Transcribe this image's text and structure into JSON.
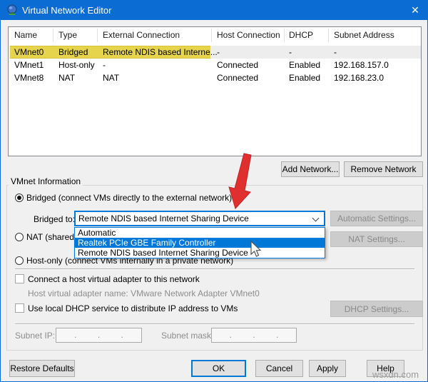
{
  "window": {
    "title": "Virtual Network Editor",
    "close_glyph": "✕"
  },
  "colors": {
    "accent": "#0078d7",
    "titlebar": "#0b6dd3",
    "row_highlight": "#e6d44c",
    "arrow_red": "#e02f2f"
  },
  "table": {
    "columns": [
      "Name",
      "Type",
      "External Connection",
      "Host Connection",
      "DHCP",
      "Subnet Address"
    ],
    "rows": [
      {
        "name": "VMnet0",
        "type": "Bridged",
        "external": "Remote NDIS based Interne...",
        "host": "-",
        "dhcp": "-",
        "subnet": "-"
      },
      {
        "name": "VMnet1",
        "type": "Host-only",
        "external": "-",
        "host": "Connected",
        "dhcp": "Enabled",
        "subnet": "192.168.157.0"
      },
      {
        "name": "VMnet8",
        "type": "NAT",
        "external": "NAT",
        "host": "Connected",
        "dhcp": "Enabled",
        "subnet": "192.168.23.0"
      }
    ]
  },
  "actions": {
    "add_network": "Add Network...",
    "remove_network": "Remove Network"
  },
  "vmnet_info": {
    "group_label": "VMnet Information",
    "bridged_label": "Bridged (connect VMs directly to the external network)",
    "bridged_to_label": "Bridged to:",
    "bridged_to_value": "Remote NDIS based Internet Sharing Device",
    "automatic_settings": "Automatic Settings...",
    "nat_label": "NAT (shared",
    "nat_settings": "NAT Settings...",
    "host_only_label": "Host-only (connect VMs internally in a private network)",
    "dropdown": {
      "items": [
        "Automatic",
        "Realtek PCIe GBE Family Controller",
        "Remote NDIS based Internet Sharing Device"
      ],
      "selected_index": 1
    },
    "connect_adapter_label": "Connect a host virtual adapter to this network",
    "adapter_name_label": "Host virtual adapter name: VMware Network Adapter VMnet0",
    "dhcp_service_label": "Use local DHCP service to distribute IP address to VMs",
    "dhcp_settings": "DHCP Settings...",
    "subnet_ip_label": "Subnet IP:",
    "subnet_mask_label": "Subnet mask:",
    "dots": ". . ."
  },
  "footer": {
    "restore_defaults": "Restore Defaults",
    "ok": "OK",
    "cancel": "Cancel",
    "apply": "Apply",
    "help": "Help"
  },
  "watermark": "wsxdn.com"
}
